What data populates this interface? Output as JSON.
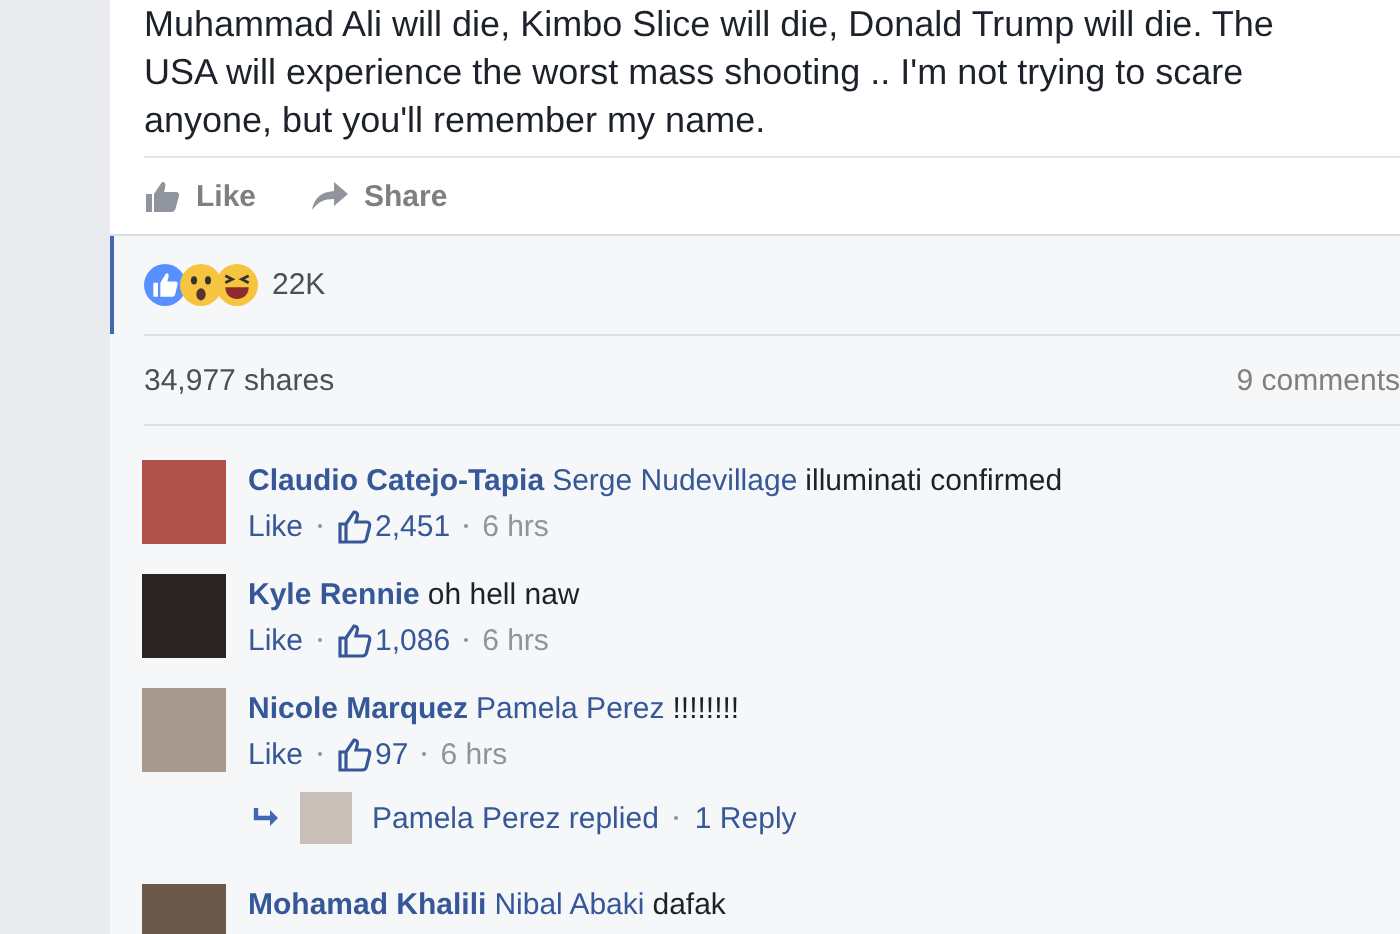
{
  "post": {
    "text_lines": [
      "Muhammad Ali will die, Kimbo Slice will die, Donald Trump will die. The",
      "USA will experience the worst mass shooting .. I'm not trying to scare",
      "anyone, but you'll remember my name."
    ]
  },
  "actions": [
    {
      "kind": "like",
      "label": "Like"
    },
    {
      "kind": "share",
      "label": "Share"
    }
  ],
  "reactions": {
    "count": "22K"
  },
  "stats": {
    "shares": "34,977 shares",
    "comments": "9 comments"
  },
  "comments": [
    {
      "author": "Claudio Catejo-Tapia",
      "tag": "Serge Nudevillage",
      "text": "illuminati confirmed",
      "like_label": "Like",
      "likes": "2,451",
      "time": "6 hrs"
    },
    {
      "author": "Kyle Rennie",
      "text": "oh hell naw",
      "like_label": "Like",
      "likes": "1,086",
      "time": "6 hrs"
    },
    {
      "author": "Nicole Marquez",
      "tag": "Pamela Perez",
      "text": "!!!!!!!!",
      "like_label": "Like",
      "likes": "97",
      "time": "6 hrs",
      "reply": {
        "text": "Pamela Perez replied",
        "count": "1 Reply"
      }
    },
    {
      "author": "Mohamad Khalili",
      "tag": "Nibal Abaki",
      "text": "dafak"
    }
  ]
}
